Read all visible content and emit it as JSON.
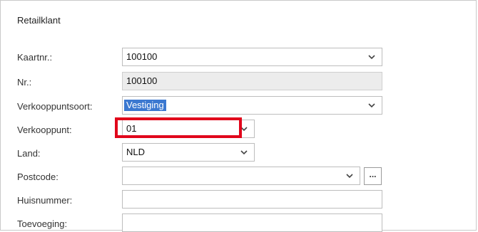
{
  "section": {
    "title": "Retailklant"
  },
  "fields": [
    {
      "label": "Kaartnr.:",
      "value": "100100",
      "dropdown": true,
      "readonly": false
    },
    {
      "label": "Nr.:",
      "value": "100100",
      "dropdown": false,
      "readonly": true
    },
    {
      "label": "Verkooppuntsoort:",
      "value": "Vestiging",
      "dropdown": true,
      "readonly": false,
      "selected": true
    },
    {
      "label": "Verkooppunt:",
      "value": "01",
      "dropdown": true,
      "readonly": false
    },
    {
      "label": "Land:",
      "value": "NLD",
      "dropdown": true,
      "readonly": false
    },
    {
      "label": "Postcode:",
      "value": "",
      "dropdown": true,
      "readonly": false
    },
    {
      "label": "Huisnummer:",
      "value": "",
      "dropdown": false,
      "readonly": false
    },
    {
      "label": "Toevoeging:",
      "value": "",
      "dropdown": false,
      "readonly": false
    }
  ],
  "lookup_button": {
    "label": "..."
  },
  "colors": {
    "highlight": "#e1061b",
    "selection": "#3b78d0"
  },
  "icons": {
    "dropdown": "chevron-down-icon"
  }
}
